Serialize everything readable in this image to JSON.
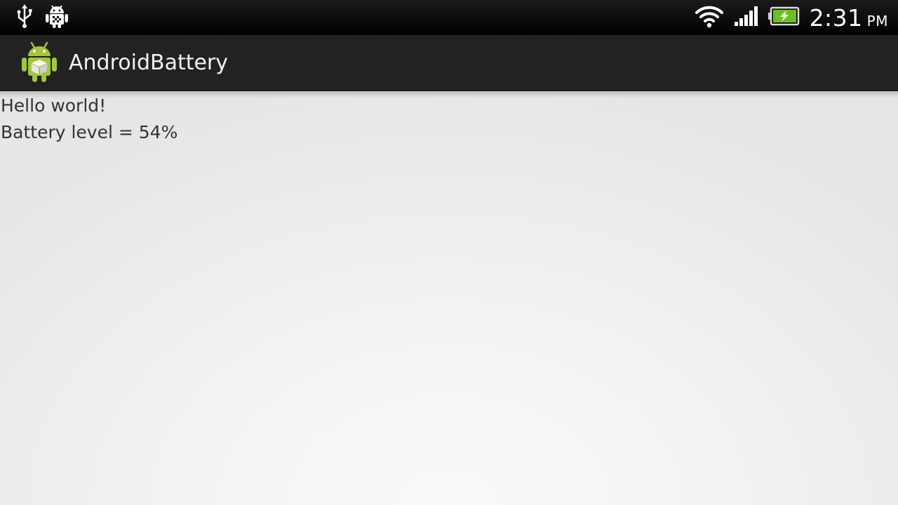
{
  "status_bar": {
    "icons_left": [
      "usb-icon",
      "android-debug-icon"
    ],
    "icons_right": [
      "wifi-icon",
      "signal-icon",
      "battery-charging-icon"
    ],
    "time": "2:31",
    "ampm": "PM",
    "battery_fill_color": "#6bbf1f"
  },
  "action_bar": {
    "app_icon": "android-app-icon",
    "title": "AndroidBattery",
    "brand_color": "#a4c639"
  },
  "content": {
    "hello_text": "Hello world!",
    "battery_text": "Battery level = 54%"
  }
}
